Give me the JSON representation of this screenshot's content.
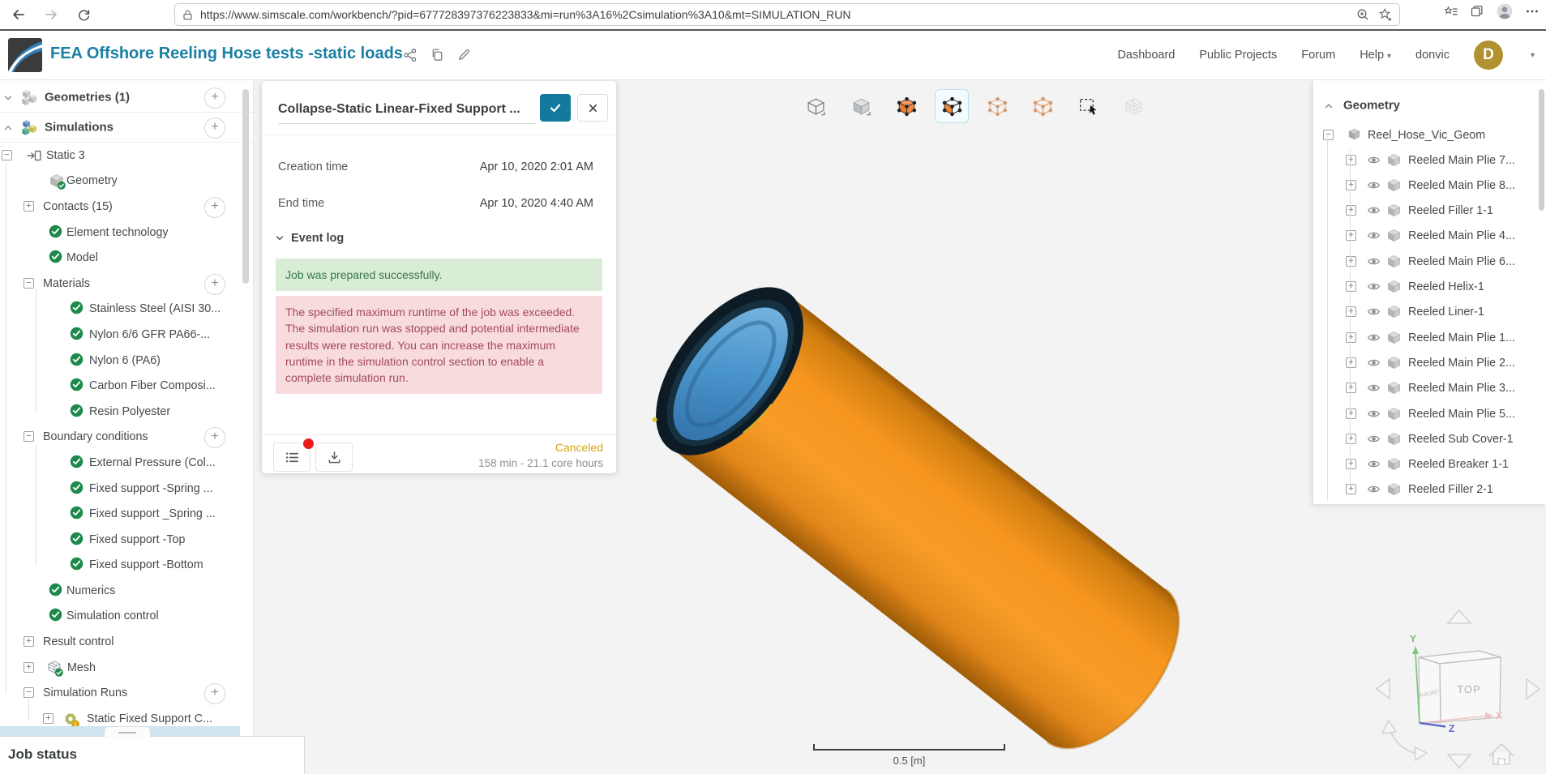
{
  "browser": {
    "url": "https://www.simscale.com/workbench/?pid=677728397376223833&mi=run%3A16%2Csimulation%3A10&mt=SIMULATION_RUN"
  },
  "header": {
    "project_title": "FEA Offshore Reeling Hose tests -static loads",
    "nav": [
      "Dashboard",
      "Public Projects",
      "Forum",
      "Help",
      "donvic"
    ],
    "avatar_letter": "D",
    "brand_color": "#1a7fa3"
  },
  "sidebar": {
    "rows": [
      {
        "label": "Geometries (1)",
        "kind": "section",
        "icon": "geometry-cubes-icon",
        "expander": "chevron-down",
        "add": true
      },
      {
        "label": "Simulations",
        "kind": "section",
        "icon": "simulation-cubes-icon",
        "expander": "chevron-up",
        "add": true
      },
      {
        "label": "Static 3",
        "kind": "analysis",
        "icon": "static-analysis-icon",
        "expander": "minus"
      },
      {
        "label": "Geometry",
        "kind": "item2",
        "icon": "cube-check-icon"
      },
      {
        "label": "Contacts (15)",
        "kind": "group",
        "expander": "plus",
        "add": true
      },
      {
        "label": "Element technology",
        "kind": "item2",
        "icon": "check-circle-icon"
      },
      {
        "label": "Model",
        "kind": "item2",
        "icon": "check-circle-icon"
      },
      {
        "label": "Materials",
        "kind": "group",
        "expander": "minus",
        "add": true
      },
      {
        "label": "Stainless Steel (AISI 30...",
        "kind": "item3",
        "icon": "check-circle-icon"
      },
      {
        "label": "Nylon 6/6 GFR PA66-...",
        "kind": "item3",
        "icon": "check-circle-icon"
      },
      {
        "label": "Nylon 6 (PA6)",
        "kind": "item3",
        "icon": "check-circle-icon"
      },
      {
        "label": "Carbon Fiber Composi...",
        "kind": "item3",
        "icon": "check-circle-icon"
      },
      {
        "label": "Resin Polyester",
        "kind": "item3",
        "icon": "check-circle-icon"
      },
      {
        "label": "Boundary conditions",
        "kind": "group",
        "expander": "minus",
        "add": true
      },
      {
        "label": "External Pressure (Col...",
        "kind": "item3",
        "icon": "check-circle-icon"
      },
      {
        "label": "Fixed support -Spring ...",
        "kind": "item3",
        "icon": "check-circle-icon"
      },
      {
        "label": "Fixed support _Spring ...",
        "kind": "item3",
        "icon": "check-circle-icon"
      },
      {
        "label": "Fixed support -Top",
        "kind": "item3",
        "icon": "check-circle-icon"
      },
      {
        "label": "Fixed support -Bottom",
        "kind": "item3",
        "icon": "check-circle-icon"
      },
      {
        "label": "Numerics",
        "kind": "item2",
        "icon": "check-circle-icon"
      },
      {
        "label": "Simulation control",
        "kind": "item2",
        "icon": "check-circle-icon"
      },
      {
        "label": "Result control",
        "kind": "group",
        "expander": "plus"
      },
      {
        "label": "Mesh",
        "kind": "mesh",
        "icon": "mesh-check-icon",
        "expander": "plus"
      },
      {
        "label": "Simulation Runs",
        "kind": "group",
        "expander": "minus",
        "add": true
      },
      {
        "label": "Static Fixed Support C...",
        "kind": "runchild",
        "icon": "gear-warning-icon",
        "expander": "plus"
      }
    ]
  },
  "dialog": {
    "title": "Collapse-Static Linear-Fixed Support ...",
    "fields": [
      {
        "label": "Creation time",
        "value": "Apr 10, 2020 2:01 AM"
      },
      {
        "label": "End time",
        "value": "Apr 10, 2020 4:40 AM"
      }
    ],
    "event_log_header": "Event log",
    "messages": [
      {
        "type": "success",
        "text": "Job was prepared successfully."
      },
      {
        "type": "error",
        "text": "The specified maximum runtime of the job was exceeded. The simulation run was stopped and potential intermediate results were restored. You can increase the maximum runtime in the simulation control section to enable a complete simulation run."
      }
    ],
    "status": "Canceled",
    "status_color": "#d7a413",
    "usage": "158 min - 21.1 core hours"
  },
  "viewport": {
    "toolbar": [
      {
        "name": "wireframe-view-icon"
      },
      {
        "name": "solid-view-icon"
      },
      {
        "name": "select-volumes-icon"
      },
      {
        "name": "select-faces-icon",
        "active": true
      },
      {
        "name": "select-edges-icon"
      },
      {
        "name": "select-vertices-icon"
      },
      {
        "name": "box-select-icon"
      },
      {
        "name": "mesh-view-icon",
        "disabled": true
      }
    ],
    "scale_label": "0.5 [m]",
    "view_cube": {
      "top": "TOP",
      "front": "FRONT",
      "axis_x": "X",
      "axis_y": "Y",
      "axis_z": "Z"
    },
    "model_colors": {
      "body": "#f6961f",
      "end_cap_ring": "#0d1b26",
      "liner": "#4a94cc"
    }
  },
  "geometry_panel": {
    "header": "Geometry",
    "root": "Reel_Hose_Vic_Geom",
    "items": [
      "Reeled Main Plie 7...",
      "Reeled Main Plie 8...",
      "Reeled Filler 1-1",
      "Reeled Main Plie 4...",
      "Reeled Main Plie 6...",
      "Reeled Helix-1",
      "Reeled Liner-1",
      "Reeled Main Plie 1...",
      "Reeled Main Plie 2...",
      "Reeled Main Plie 3...",
      "Reeled Main Plie 5...",
      "Reeled Sub Cover-1",
      "Reeled Breaker 1-1",
      "Reeled Filler 2-1"
    ]
  },
  "job_status": {
    "label": "Job status"
  }
}
